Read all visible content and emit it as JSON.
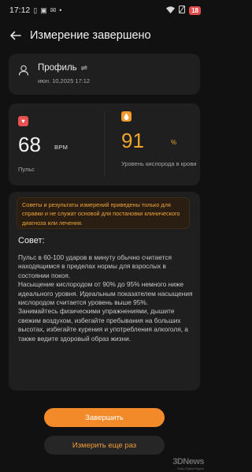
{
  "status": {
    "time": "17:12",
    "battery": "18"
  },
  "header": {
    "title": "Измерение завершено"
  },
  "profile": {
    "name": "Профиль",
    "date": "июн. 10,2025 17:12"
  },
  "pulse": {
    "value": "68",
    "unit": "BPM",
    "label": "Пульс"
  },
  "spo2": {
    "value": "91",
    "unit": "%",
    "label": "Уровень кислорода в крови"
  },
  "advice": {
    "disclaimer": "Советы и результаты измерений приведены только для справки и не служат основой для постановки клинического диагноза или лечения.",
    "heading": "Совет:",
    "paragraphs": [
      "Пульс в 60-100 ударов в минуту обычно считается находящимся в пределах нормы для взрослых в состоянии покоя.",
      "Насыщение кислородом от 90% до 95% немного ниже идеального уровня. Идеальным показателем насыщения кислородом считается уровень выше 95%.",
      "Занимайтесь физическими упражнениями, дышите свежим воздухом, избегайте пребывания на больших высотах, избегайте курения и употребления алкоголя, а также ведите здоровый образ жизни."
    ]
  },
  "buttons": {
    "finish": "Завершить",
    "remeasure": "Измерить еще раз"
  },
  "watermark": {
    "logo": "3DNews",
    "sub": "Daily Digital Digest"
  },
  "colors": {
    "accent": "#f28a2a",
    "spo2": "#f4a52a",
    "heart": "#e8514f",
    "background": "#111111",
    "card": "#1f1f1f"
  }
}
